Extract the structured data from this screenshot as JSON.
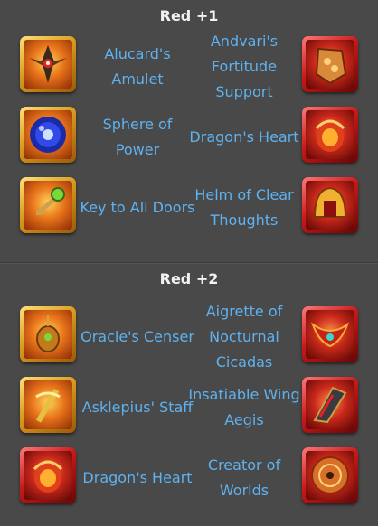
{
  "sections": [
    {
      "title": "Red +1",
      "rows": [
        {
          "left": {
            "name": "Alucard's Amulet",
            "icon": "alucards-amulet-icon"
          },
          "right": {
            "name": "Andvari's Fortitude Support",
            "icon": "andvaris-fortitude-support-icon"
          }
        },
        {
          "left": {
            "name": "Sphere of Power",
            "icon": "sphere-of-power-icon"
          },
          "right": {
            "name": "Dragon's Heart",
            "icon": "dragons-heart-icon"
          }
        },
        {
          "left": {
            "name": "Key to All Doors",
            "icon": "key-to-all-doors-icon"
          },
          "right": {
            "name": "Helm of Clear Thoughts",
            "icon": "helm-of-clear-thoughts-icon"
          }
        }
      ]
    },
    {
      "title": "Red +2",
      "rows": [
        {
          "left": {
            "name": "Oracle's Censer",
            "icon": "oracles-censer-icon"
          },
          "right": {
            "name": "Aigrette of Nocturnal Cicadas",
            "icon": "aigrette-of-nocturnal-cicadas-icon"
          }
        },
        {
          "left": {
            "name": "Asklepius' Staff",
            "icon": "asklepius-staff-icon"
          },
          "right": {
            "name": "Insatiable Wing Aegis",
            "icon": "insatiable-wing-aegis-icon"
          }
        },
        {
          "left": {
            "name": "Dragon's Heart",
            "icon": "dragons-heart-icon"
          },
          "right": {
            "name": "Creator of Worlds",
            "icon": "creator-of-worlds-icon"
          }
        }
      ]
    }
  ],
  "colors": {
    "background": "#494949",
    "title": "#f2f2f2",
    "item_name": "#5fb2f0",
    "gold_frame": "#d79a1c",
    "red_frame": "#c81818"
  }
}
